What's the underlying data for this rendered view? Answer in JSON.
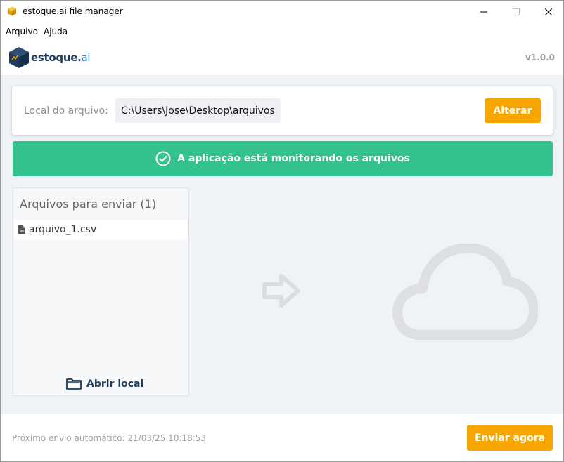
{
  "window": {
    "title": "estoque.ai file manager"
  },
  "menu": {
    "items": [
      "Arquivo",
      "Ajuda"
    ]
  },
  "header": {
    "logo_name": "estoque",
    "logo_dot": ".",
    "logo_suffix": "ai",
    "version": "v1.0.0"
  },
  "path": {
    "label": "Local do arquivo:",
    "value": "C:\\Users\\Jose\\Desktop\\arquivos",
    "change_label": "Alterar"
  },
  "status": {
    "message": "A aplicação está monitorando os arquivos",
    "color": "#34c38f"
  },
  "files": {
    "title": "Arquivos para enviar (1)",
    "items": [
      {
        "name": "arquivo_1.csv",
        "icon": "file-icon"
      }
    ],
    "open_local_label": "Abrir local"
  },
  "footer": {
    "next_send": "Próximo envio automático: 21/03/25 10:18:53",
    "send_now_label": "Enviar agora"
  },
  "colors": {
    "accent": "#f7a600",
    "brand": "#1e3a5c",
    "success": "#34c38f",
    "background": "#eff2f6"
  }
}
